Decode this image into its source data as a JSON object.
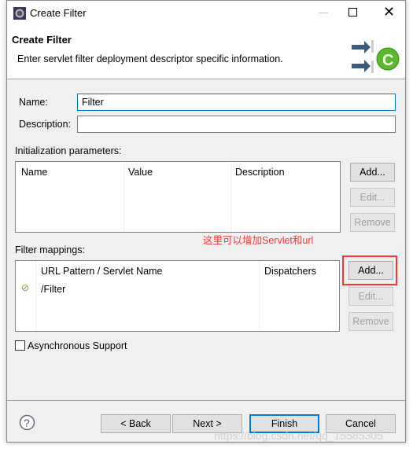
{
  "window": {
    "title": "Create Filter"
  },
  "header": {
    "title": "Create Filter",
    "description": "Enter servlet filter deployment descriptor specific information."
  },
  "form": {
    "name_label": "Name:",
    "name_value": "Filter",
    "description_label": "Description:",
    "description_value": ""
  },
  "init_params": {
    "label": "Initialization parameters:",
    "columns": [
      "Name",
      "Value",
      "Description"
    ],
    "rows": [],
    "buttons": {
      "add": "Add...",
      "edit": "Edit...",
      "remove": "Remove"
    }
  },
  "annotation": {
    "text": "这里可以增加Servlet和url",
    "color": "#ff3333"
  },
  "filter_mappings": {
    "label": "Filter mappings:",
    "columns": [
      "URL Pattern / Servlet Name",
      "Dispatchers"
    ],
    "rows": [
      {
        "pattern": "/Filter",
        "dispatchers": ""
      }
    ],
    "buttons": {
      "add": "Add...",
      "edit": "Edit...",
      "remove": "Remove"
    }
  },
  "async": {
    "label": "Asynchronous Support",
    "checked": false
  },
  "footer": {
    "back": "< Back",
    "next": "Next >",
    "finish": "Finish",
    "cancel": "Cancel"
  },
  "watermark": "https://blog.csdn.net/qq_15585305",
  "colors": {
    "accent": "#0078d7",
    "highlight_box": "#ff3333"
  }
}
